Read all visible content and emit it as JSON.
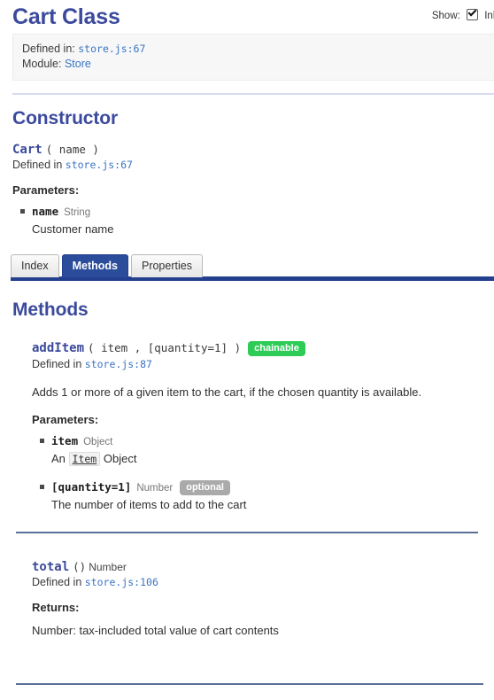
{
  "header": {
    "title": "Cart Class",
    "show_label": "Show:",
    "show_checkbox_label": "Inherited",
    "checkbox_checked": true
  },
  "meta": {
    "defined_in_label": "Defined in:",
    "defined_in_value": "store.js:67",
    "module_label": "Module:",
    "module_value": "Store"
  },
  "constructor": {
    "heading": "Constructor",
    "name": "Cart",
    "args": "( name )",
    "defined_prefix": "Defined in",
    "defined_link": "store.js:67",
    "params_heading": "Parameters:",
    "params": [
      {
        "name": "name",
        "type": "String",
        "desc": "Customer name"
      }
    ]
  },
  "tabs": {
    "items": [
      {
        "label": "Index",
        "active": false
      },
      {
        "label": "Methods",
        "active": true
      },
      {
        "label": "Properties",
        "active": false
      }
    ]
  },
  "methods_panel": {
    "heading": "Methods",
    "methods": [
      {
        "name": "addItem",
        "args": "( item , [quantity=1] )",
        "badge": "chainable",
        "badge_color": "#2ecc56",
        "defined_prefix": "Defined in",
        "defined_link": "store.js:87",
        "description": "Adds 1 or more of a given item to the cart, if the chosen quantity is available.",
        "params_heading": "Parameters:",
        "params": [
          {
            "name": "item",
            "type": "Object",
            "badge": "",
            "desc_before": "An",
            "desc_code": "Item",
            "desc_after": "Object"
          },
          {
            "name": "[quantity=1]",
            "type": "Number",
            "badge": "optional",
            "desc_before": "The number of items to add to the cart",
            "desc_code": "",
            "desc_after": ""
          }
        ]
      },
      {
        "name": "total",
        "args": "()",
        "return_type": "Number",
        "defined_prefix": "Defined in",
        "defined_link": "store.js:106",
        "returns_heading": "Returns:",
        "returns_body": "Number: tax-included total value of cart contents"
      }
    ]
  },
  "colors": {
    "title_blue": "#3b4a9c",
    "link_blue": "#3a74c4",
    "tab_active": "#2b4c9b",
    "tab_bar": "#23408f",
    "rule_lavender": "#d6dbee",
    "rule_slate": "#5a7099",
    "badge_green": "#2ecc56",
    "badge_gray": "#aaaaaa"
  }
}
